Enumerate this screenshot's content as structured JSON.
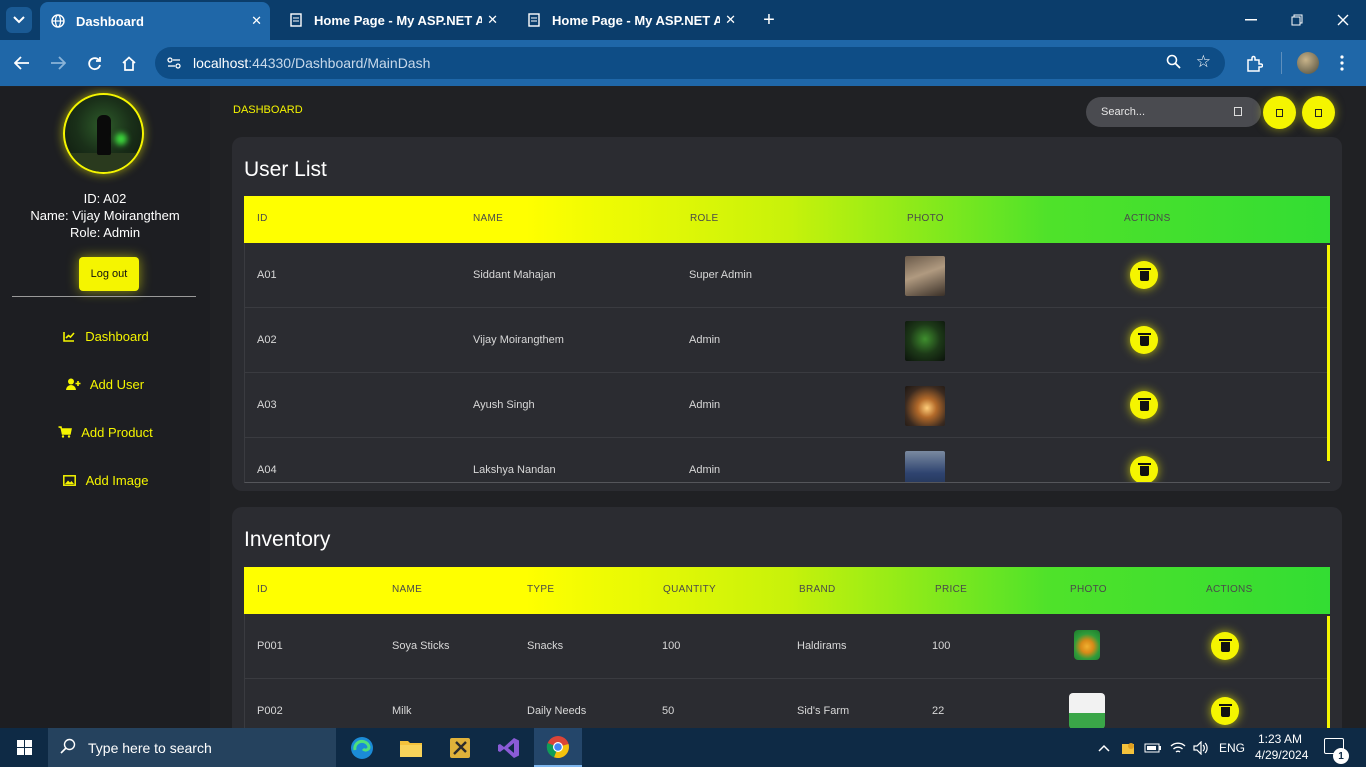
{
  "browser": {
    "tabs": [
      {
        "title": "Dashboard",
        "active": true,
        "icon": "globe-icon"
      },
      {
        "title": "Home Page - My ASP.NET App",
        "active": false,
        "icon": "document-icon"
      },
      {
        "title": "Home Page - My ASP.NET App",
        "active": false,
        "icon": "document-icon"
      }
    ],
    "url_host": "localhost",
    "url_path": ":44330/Dashboard/MainDash"
  },
  "sidebar": {
    "user_id": "ID: A02",
    "user_name": "Name: Vijay Moirangthem",
    "user_role": "Role: Admin",
    "logout_label": "Log out",
    "items": [
      {
        "label": "Dashboard",
        "icon": "chart-icon"
      },
      {
        "label": "Add User",
        "icon": "add-user-icon"
      },
      {
        "label": "Add Product",
        "icon": "cart-icon"
      },
      {
        "label": "Add Image",
        "icon": "image-icon"
      }
    ]
  },
  "header": {
    "breadcrumb": "DASHBOARD",
    "search_placeholder": "Search..."
  },
  "user_list": {
    "title": "User List",
    "columns": [
      "ID",
      "NAME",
      "ROLE",
      "PHOTO",
      "ACTIONS"
    ],
    "rows": [
      {
        "id": "A01",
        "name": "Siddant Mahajan",
        "role": "Super Admin"
      },
      {
        "id": "A02",
        "name": "Vijay Moirangthem",
        "role": "Admin"
      },
      {
        "id": "A03",
        "name": "Ayush Singh",
        "role": "Admin"
      },
      {
        "id": "A04",
        "name": "Lakshya Nandan",
        "role": "Admin"
      }
    ]
  },
  "inventory": {
    "title": "Inventory",
    "columns": [
      "ID",
      "NAME",
      "TYPE",
      "QUANTITY",
      "BRAND",
      "PRICE",
      "PHOTO",
      "ACTIONS"
    ],
    "rows": [
      {
        "id": "P001",
        "name": "Soya Sticks",
        "type": "Snacks",
        "quantity": "100",
        "brand": "Haldirams",
        "price": "100"
      },
      {
        "id": "P002",
        "name": "Milk",
        "type": "Daily Needs",
        "quantity": "50",
        "brand": "Sid's Farm",
        "price": "22"
      }
    ]
  },
  "taskbar": {
    "search_placeholder": "Type here to search",
    "language": "ENG",
    "time": "1:23 AM",
    "date": "4/29/2024",
    "notification_count": "1"
  },
  "colors": {
    "accent": "#f5f500",
    "header_gradient_end": "#33dd33",
    "chrome_blue": "#1f67a8"
  }
}
